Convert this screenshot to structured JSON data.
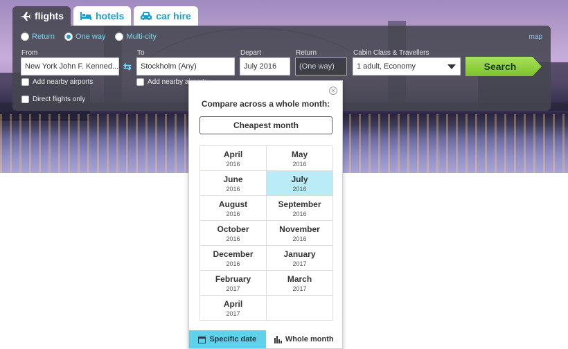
{
  "tabs": [
    {
      "label": "flights",
      "icon": "plane-icon",
      "active": true
    },
    {
      "label": "hotels",
      "icon": "bed-icon",
      "active": false
    },
    {
      "label": "car hire",
      "icon": "car-icon",
      "active": false
    }
  ],
  "trip_types": [
    {
      "label": "Return",
      "checked": false
    },
    {
      "label": "One way",
      "checked": true
    },
    {
      "label": "Multi-city",
      "checked": false
    }
  ],
  "map_link": "map",
  "form": {
    "from_label": "From",
    "from_value": "New York John F. Kenned...",
    "to_label": "To",
    "to_value": "Stockholm (Any)",
    "depart_label": "Depart",
    "depart_value": "July 2016",
    "return_label": "Return",
    "return_value": "(One way)",
    "cabin_label": "Cabin Class & Travellers",
    "cabin_value": "1 adult, Economy",
    "search_label": "Search",
    "nearby_from": "Add nearby airports",
    "nearby_to": "Add nearby airports",
    "direct_only": "Direct flights only"
  },
  "month_picker": {
    "title": "Compare across a whole month:",
    "cheapest_label": "Cheapest month",
    "months": [
      {
        "month": "April",
        "year": "2016"
      },
      {
        "month": "May",
        "year": "2016"
      },
      {
        "month": "June",
        "year": "2016"
      },
      {
        "month": "July",
        "year": "2016",
        "selected": true
      },
      {
        "month": "August",
        "year": "2016"
      },
      {
        "month": "September",
        "year": "2016"
      },
      {
        "month": "October",
        "year": "2016"
      },
      {
        "month": "November",
        "year": "2016"
      },
      {
        "month": "December",
        "year": "2016"
      },
      {
        "month": "January",
        "year": "2017"
      },
      {
        "month": "February",
        "year": "2017"
      },
      {
        "month": "March",
        "year": "2017"
      },
      {
        "month": "April",
        "year": "2017"
      }
    ],
    "specific_date_label": "Specific date",
    "whole_month_label": "Whole month"
  },
  "colors": {
    "accent": "#1ba0c8",
    "selected_month": "#b9ecf6",
    "search_button": "#7cc32b",
    "active_popup_tab": "#5fd2ea"
  }
}
